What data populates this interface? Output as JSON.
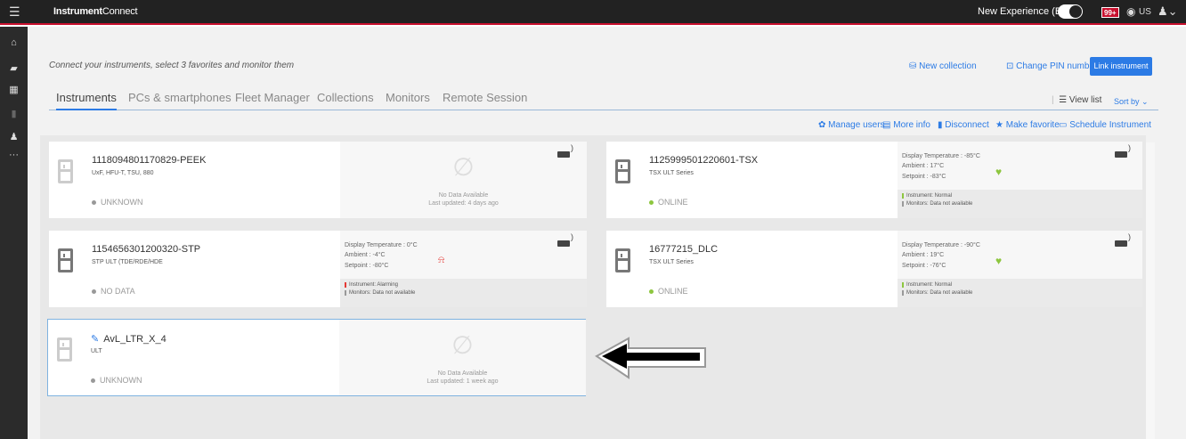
{
  "header": {
    "brand_bold": "Instrument",
    "brand_rest": "Connect",
    "beta_label": "New Experience (Beta)",
    "badge": "99+",
    "lang": "US"
  },
  "colors": {
    "accent": "#2c7be5",
    "online": "#8dc63f",
    "alarm": "#e53935",
    "topbar": "#222222",
    "topbar_border": "#c8102e"
  },
  "page": {
    "subtitle": "Connect your instruments, select 3 favorites and monitor them",
    "new_collection": "New collection",
    "change_pin": "Change PIN number",
    "link_instrument": "Link instrument"
  },
  "tabs": [
    "Instruments",
    "PCs & smartphones",
    "Fleet Manager",
    "Collections",
    "Monitors",
    "Remote Session"
  ],
  "view_list": "View list",
  "sort_by": "Sort by",
  "actions": [
    "Manage users",
    "More info",
    "Disconnect",
    "Make favorite",
    "Schedule Instrument"
  ],
  "cards": [
    {
      "name": "1118094801170829-PEEK",
      "model": "UxF, HFU-T, TSU, 880",
      "status": "UNKNOWN",
      "no_data": "No Data Available",
      "last_updated": "Last updated: 4 days ago"
    },
    {
      "name": "1125999501220601-TSX",
      "model": "TSX ULT Series",
      "status": "ONLINE",
      "display_temp": "Display Temperature : -85°C",
      "ambient": "Ambient : 17°C",
      "setpoint": "Setpoint : -83°C",
      "instrument_status": "Instrument: Normal",
      "monitors": "Monitors: Data not available"
    },
    {
      "name": "1154656301200320-STP",
      "model": "STP ULT (TDE/RDE/HDE",
      "status": "NO DATA",
      "display_temp": "Display Temperature : 0°C",
      "ambient": "Ambient : -4°C",
      "setpoint": "Setpoint : -80°C",
      "instrument_status": "Instrument: Alarming",
      "monitors": "Monitors: Data not available"
    },
    {
      "name": "16777215_DLC",
      "model": "TSX ULT Series",
      "status": "ONLINE",
      "display_temp": "Display Temperature : -90°C",
      "ambient": "Ambient : 19°C",
      "setpoint": "Setpoint : -76°C",
      "instrument_status": "Instrument: Normal",
      "monitors": "Monitors: Data not available"
    },
    {
      "name": "AvL_LTR_X_4",
      "model": "ULT",
      "status": "UNKNOWN",
      "no_data": "No Data Available",
      "last_updated": "Last updated: 1 week ago"
    }
  ]
}
